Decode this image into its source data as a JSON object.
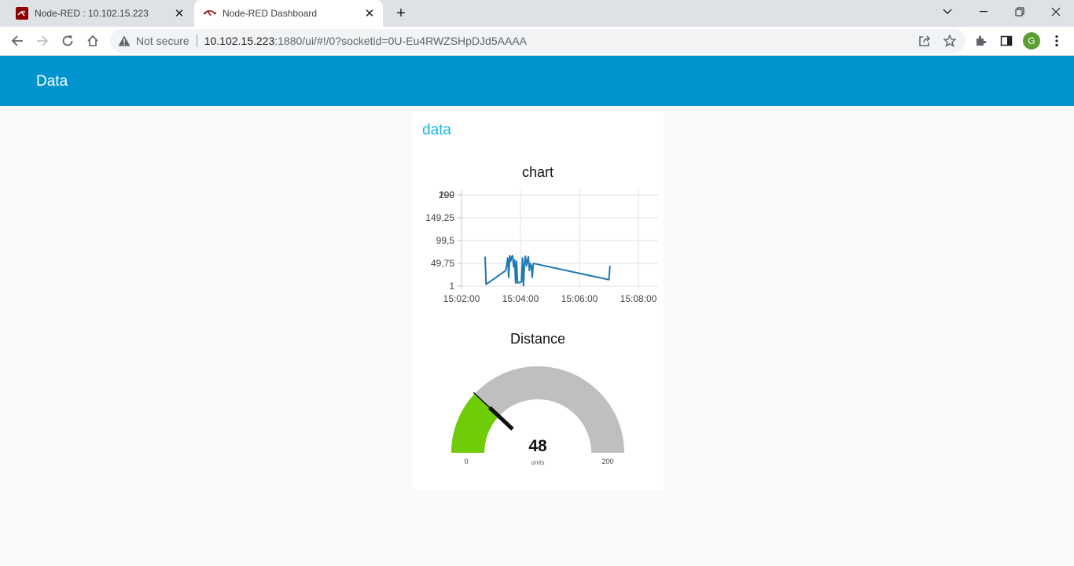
{
  "browser": {
    "tabs": [
      {
        "title": "Node-RED : 10.102.15.223",
        "active": false
      },
      {
        "title": "Node-RED Dashboard",
        "active": true
      }
    ],
    "address": {
      "security_label": "Not secure",
      "host": "10.102.15.223",
      "path": ":1880/ui/#!/0?socketid=0U-Eu4RWZSHpDJd5AAAA"
    },
    "profile_initial": "G"
  },
  "dashboard": {
    "title": "Data",
    "group_title": "data"
  },
  "chart_widget": {
    "title": "chart"
  },
  "chart_data": {
    "type": "line",
    "title": "chart",
    "y_ticks": [
      "200",
      "149,25",
      "99,5",
      "49,75",
      "1"
    ],
    "y_tick_overlap": "199",
    "x_ticks": [
      "15:02:00",
      "15:04:00",
      "15:06:00",
      "15:08:00"
    ],
    "ylim": [
      1,
      199
    ],
    "xlim": [
      "15:02:00",
      "15:08:40"
    ],
    "grid": true,
    "color": "#1f77b4",
    "series": [
      {
        "x": [
          "15:02:48",
          "15:02:50",
          "15:03:30",
          "15:03:34",
          "15:03:36",
          "15:03:38",
          "15:03:40",
          "15:03:42",
          "15:03:44",
          "15:03:46",
          "15:03:48",
          "15:03:50",
          "15:03:52",
          "15:03:54",
          "15:04:02",
          "15:04:04",
          "15:04:06",
          "15:04:08",
          "15:04:10",
          "15:04:12",
          "15:04:16",
          "15:04:18",
          "15:04:20",
          "15:04:22",
          "15:04:24",
          "15:04:26",
          "15:04:28",
          "15:07:00",
          "15:07:02"
        ],
        "y": [
          65,
          5,
          35,
          62,
          20,
          67,
          55,
          65,
          67,
          43,
          58,
          8,
          55,
          8,
          10,
          62,
          2,
          50,
          66,
          45,
          65,
          35,
          50,
          45,
          20,
          50,
          50,
          15,
          45
        ]
      }
    ]
  },
  "gauge": {
    "title": "Distance",
    "value": 48,
    "value_label": "48",
    "units": "units",
    "min": 0,
    "max": 200,
    "min_label": "0",
    "max_label": "200",
    "fill_color": "#6fcc06",
    "track_color": "#bfbfbf"
  }
}
